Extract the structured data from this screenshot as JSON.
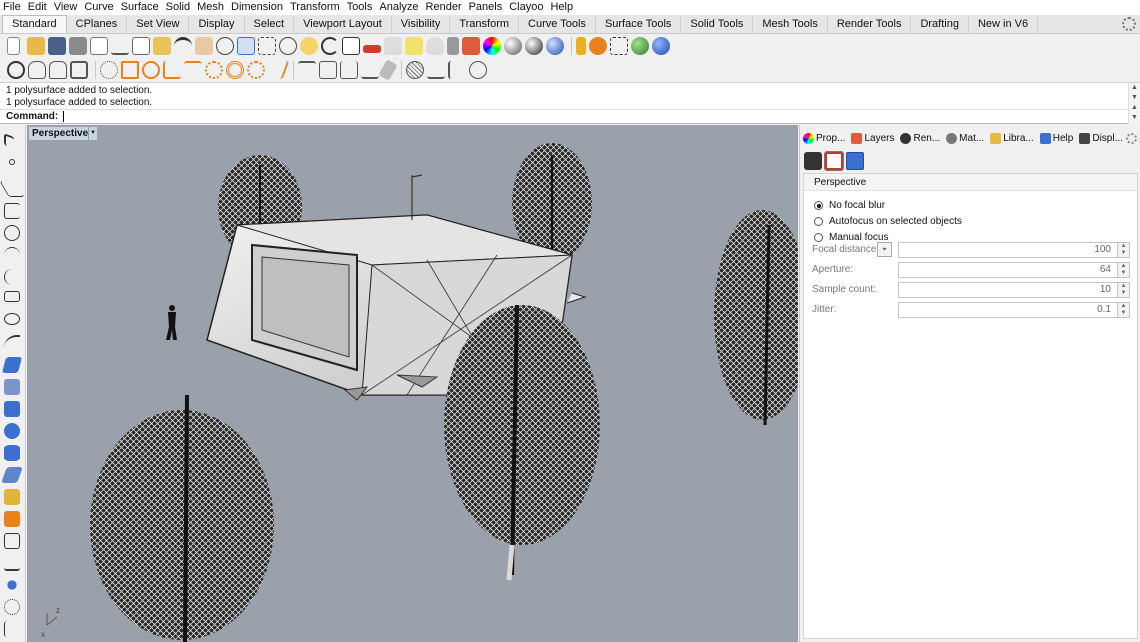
{
  "menu": [
    "File",
    "Edit",
    "View",
    "Curve",
    "Surface",
    "Solid",
    "Mesh",
    "Dimension",
    "Transform",
    "Tools",
    "Analyze",
    "Render",
    "Panels",
    "Clayoo",
    "Help"
  ],
  "tabs": [
    "Standard",
    "CPlanes",
    "Set View",
    "Display",
    "Select",
    "Viewport Layout",
    "Visibility",
    "Transform",
    "Curve Tools",
    "Surface Tools",
    "Solid Tools",
    "Mesh Tools",
    "Render Tools",
    "Drafting",
    "New in V6"
  ],
  "command": {
    "history": [
      "1 polysurface added to selection.",
      "1 polysurface added to selection."
    ],
    "prompt": "Command:",
    "scroll_up": "▲",
    "scroll_down": "▼"
  },
  "viewport": {
    "label": "Perspective",
    "dropdown": "▼",
    "axis_z": "z",
    "axis_x": "x"
  },
  "panel": {
    "tabs": [
      "Prop...",
      "Layers",
      "Ren...",
      "Mat...",
      "Libra...",
      "Help",
      "Displ..."
    ],
    "section": "Perspective",
    "radios": [
      {
        "label": "No focal blur",
        "checked": true
      },
      {
        "label": "Autofocus on selected objects",
        "checked": false
      },
      {
        "label": "Manual focus",
        "checked": false
      }
    ],
    "fields": [
      {
        "label": "Focal distance:",
        "value": "100",
        "has_picker": true
      },
      {
        "label": "Aperture:",
        "value": "64",
        "has_picker": false
      },
      {
        "label": "Sample count:",
        "value": "10",
        "has_picker": false
      },
      {
        "label": "Jitter:",
        "value": "0.1",
        "has_picker": false
      }
    ],
    "picker_symbol": "⌖",
    "spin_up": "▲",
    "spin_down": "▼"
  },
  "colors": {
    "viewport_bg": "#9aa1ab",
    "active_label_bg": "#c9d4e2",
    "icon_blue": "#3b6fd0",
    "icon_orange": "#e8821e",
    "icon_green": "#3f9b3f"
  }
}
